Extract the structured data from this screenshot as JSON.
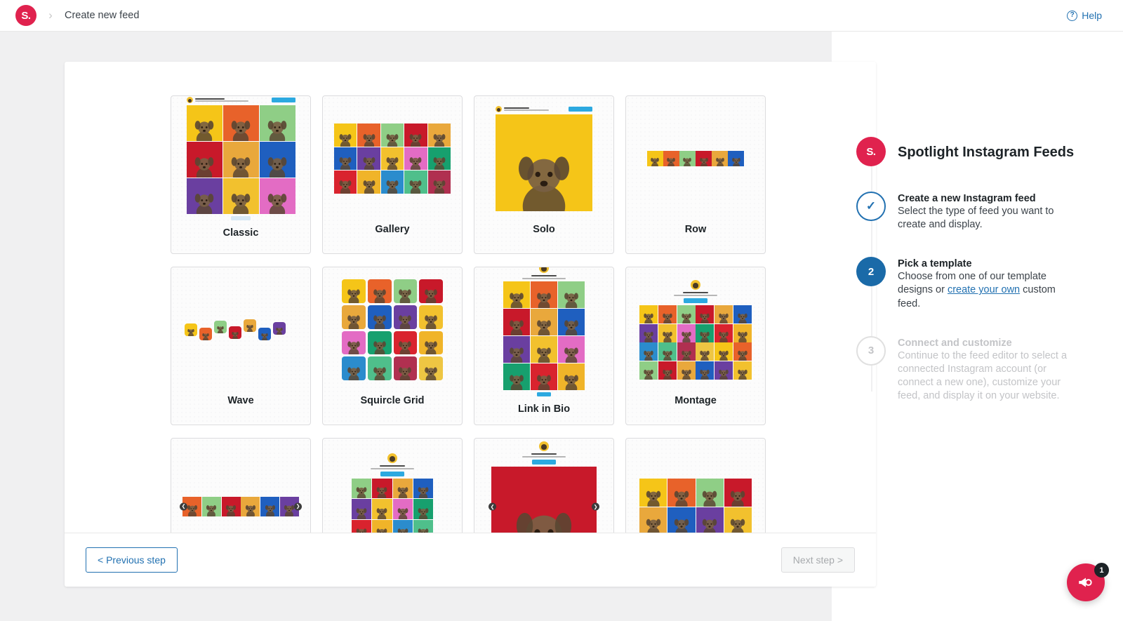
{
  "header": {
    "logo_text": "S.",
    "breadcrumb": "Create new feed",
    "help_label": "Help",
    "help_icon": "question-circle-icon",
    "separator": "›"
  },
  "templates": [
    {
      "label": "Classic",
      "preview": "grid-3x3-header"
    },
    {
      "label": "Gallery",
      "preview": "grid-5x3"
    },
    {
      "label": "Solo",
      "preview": "solo-header"
    },
    {
      "label": "Row",
      "preview": "row-6"
    },
    {
      "label": "Wave",
      "preview": "wave-7"
    },
    {
      "label": "Squircle Grid",
      "preview": "squircle-4x4"
    },
    {
      "label": "Link in Bio",
      "preview": "linkinbio-3x4"
    },
    {
      "label": "Montage",
      "preview": "montage"
    },
    {
      "label": "",
      "preview": "carousel-row"
    },
    {
      "label": "",
      "preview": "masonry-tall"
    },
    {
      "label": "",
      "preview": "slideshow"
    },
    {
      "label": "",
      "preview": "mosaic"
    }
  ],
  "footer": {
    "previous_label": "< Previous step",
    "next_label": "Next step >",
    "next_disabled": true
  },
  "sidebar": {
    "logo_text": "S.",
    "title": "Spotlight Instagram Feeds",
    "steps": [
      {
        "marker": "✓",
        "state": "done",
        "title": "Create a new Instagram feed",
        "desc": "Select the type of feed you want to create and display."
      },
      {
        "marker": "2",
        "state": "active",
        "title": "Pick a template",
        "desc_before": "Choose from one of our template designs or ",
        "link": "create your own",
        "desc_after": " custom feed."
      },
      {
        "marker": "3",
        "state": "todo",
        "title": "Connect and customize",
        "desc": "Continue to the feed editor to select a connected Instagram account (or connect a new one), customize your feed, and display it on your website."
      }
    ]
  },
  "chat": {
    "icon": "megaphone-icon",
    "badge_count": "1"
  },
  "colors": {
    "brand": "#e0224e",
    "link": "#2271b1",
    "active_step": "#1a6aa8",
    "page_bg": "#f0f0f1"
  },
  "palette": [
    "#f5c518",
    "#e8622a",
    "#8fce86",
    "#c8192a",
    "#e9a83c",
    "#1f5fbf",
    "#6a3fa0",
    "#f2c12e",
    "#e36cc4",
    "#17a06e",
    "#d9232e",
    "#f0b429",
    "#2b8ccd",
    "#4fbf8b",
    "#b03050",
    "#eec643"
  ]
}
